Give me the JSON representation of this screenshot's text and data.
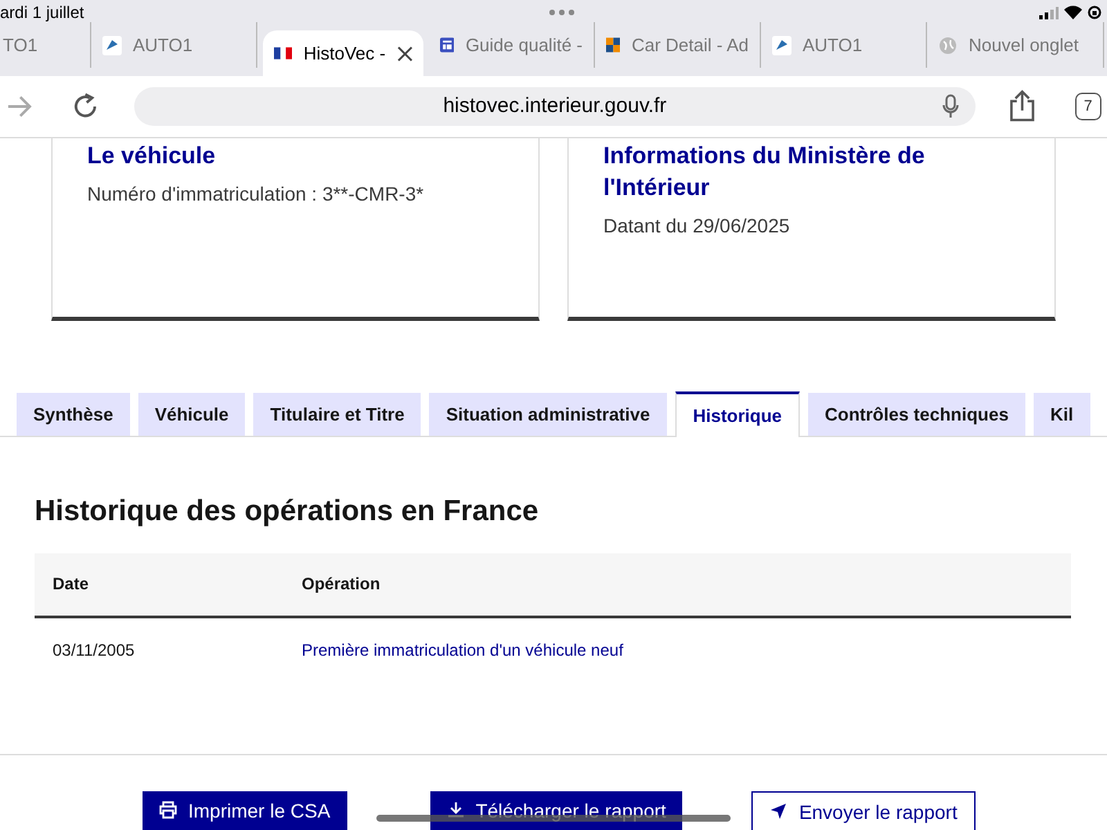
{
  "status_bar": {
    "date": "ardi 1 juillet"
  },
  "browser_tabs": [
    {
      "label": "TO1",
      "kind": "plain",
      "selected": false
    },
    {
      "label": "AUTO1",
      "kind": "app",
      "selected": false
    },
    {
      "label": "HistoVec -",
      "kind": "flag",
      "selected": true
    },
    {
      "label": "Guide qualité -",
      "kind": "layout",
      "selected": false
    },
    {
      "label": "Car Detail - Ad",
      "kind": "squares",
      "selected": false
    },
    {
      "label": "AUTO1",
      "kind": "app",
      "selected": false
    },
    {
      "label": "Nouvel onglet",
      "kind": "globe",
      "selected": false
    }
  ],
  "address_bar": {
    "url": "histovec.interieur.gouv.fr",
    "tab_count": "7"
  },
  "cards": [
    {
      "title": "Le véhicule",
      "text": "Numéro d'immatriculation : 3**-CMR-3*"
    },
    {
      "title": "Informations du Ministère de l'Intérieur",
      "text": "Datant du 29/06/2025"
    }
  ],
  "tabs": [
    {
      "label": "Synthèse",
      "selected": false
    },
    {
      "label": "Véhicule",
      "selected": false
    },
    {
      "label": "Titulaire et Titre",
      "selected": false
    },
    {
      "label": "Situation administrative",
      "selected": false
    },
    {
      "label": "Historique",
      "selected": true
    },
    {
      "label": "Contrôles techniques",
      "selected": false
    },
    {
      "label": "Kil",
      "selected": false
    }
  ],
  "section": {
    "title": "Historique des opérations en France",
    "table": {
      "columns": [
        "Date",
        "Opération"
      ],
      "rows": [
        [
          "03/11/2005",
          "Première immatriculation d'un véhicule neuf"
        ]
      ]
    }
  },
  "buttons": [
    {
      "label": "Imprimer le CSA",
      "kind": "primary"
    },
    {
      "label": "Télécharger le rapport",
      "kind": "primary"
    },
    {
      "label": "Envoyer le rapport",
      "kind": "secondary"
    }
  ]
}
